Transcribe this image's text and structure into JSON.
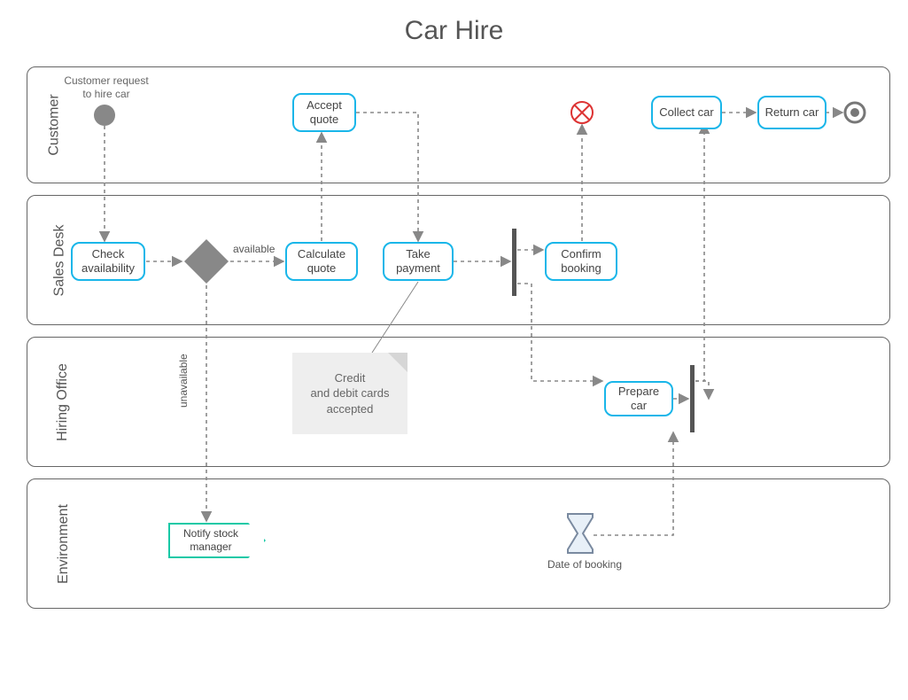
{
  "title": "Car Hire",
  "lanes": {
    "customer": "Customer",
    "sales": "Sales Desk",
    "hiring": "Hiring Office",
    "env": "Environment"
  },
  "start_event_label": "Customer request\nto hire car",
  "tasks": {
    "accept_quote": "Accept quote",
    "collect_car": "Collect car",
    "return_car": "Return car",
    "check_avail": "Check availability",
    "calc_quote": "Calculate quote",
    "take_payment": "Take payment",
    "confirm_book": "Confirm booking",
    "prepare_car": "Prepare car",
    "notify_stock": "Notify stock manager"
  },
  "edge_labels": {
    "available": "available",
    "unavailable": "unavailable"
  },
  "note": "Credit\nand debit cards\naccepted",
  "timer_label": "Date of booking",
  "chart_data": {
    "type": "bpmn_process",
    "title": "Car Hire",
    "pools": [
      {
        "name": "Customer",
        "lanes": [
          "Customer"
        ]
      },
      {
        "name": "Sales Desk",
        "lanes": [
          "Sales Desk"
        ]
      },
      {
        "name": "Hiring Office",
        "lanes": [
          "Hiring Office"
        ]
      },
      {
        "name": "Environment",
        "lanes": [
          "Environment"
        ]
      }
    ],
    "nodes": [
      {
        "id": "start",
        "type": "start_event",
        "lane": "Customer",
        "label": "Customer request to hire car"
      },
      {
        "id": "cancel",
        "type": "cancel_event",
        "lane": "Customer"
      },
      {
        "id": "end",
        "type": "end_event",
        "lane": "Customer"
      },
      {
        "id": "accept_quote",
        "type": "task",
        "lane": "Customer",
        "label": "Accept quote"
      },
      {
        "id": "collect_car",
        "type": "task",
        "lane": "Customer",
        "label": "Collect car"
      },
      {
        "id": "return_car",
        "type": "task",
        "lane": "Customer",
        "label": "Return car"
      },
      {
        "id": "check_avail",
        "type": "task",
        "lane": "Sales Desk",
        "label": "Check availability"
      },
      {
        "id": "gw_avail",
        "type": "exclusive_gateway",
        "lane": "Sales Desk"
      },
      {
        "id": "calc_quote",
        "type": "task",
        "lane": "Sales Desk",
        "label": "Calculate quote"
      },
      {
        "id": "take_payment",
        "type": "task",
        "lane": "Sales Desk",
        "label": "Take payment",
        "annotation": "Credit and debit cards accepted"
      },
      {
        "id": "fork",
        "type": "parallel_gateway",
        "lane": "Sales Desk"
      },
      {
        "id": "confirm_book",
        "type": "task",
        "lane": "Sales Desk",
        "label": "Confirm booking"
      },
      {
        "id": "prepare_car",
        "type": "task",
        "lane": "Hiring Office",
        "label": "Prepare car"
      },
      {
        "id": "join",
        "type": "parallel_gateway",
        "lane": "Hiring Office"
      },
      {
        "id": "notify_stock",
        "type": "send_task",
        "lane": "Environment",
        "label": "Notify stock manager"
      },
      {
        "id": "timer",
        "type": "timer_event",
        "lane": "Environment",
        "label": "Date of booking"
      }
    ],
    "edges": [
      {
        "from": "start",
        "to": "check_avail"
      },
      {
        "from": "check_avail",
        "to": "gw_avail"
      },
      {
        "from": "gw_avail",
        "to": "calc_quote",
        "label": "available"
      },
      {
        "from": "gw_avail",
        "to": "notify_stock",
        "label": "unavailable"
      },
      {
        "from": "calc_quote",
        "to": "accept_quote"
      },
      {
        "from": "accept_quote",
        "to": "take_payment"
      },
      {
        "from": "take_payment",
        "to": "fork"
      },
      {
        "from": "fork",
        "to": "confirm_book"
      },
      {
        "from": "fork",
        "to": "prepare_car"
      },
      {
        "from": "confirm_book",
        "to": "cancel"
      },
      {
        "from": "prepare_car",
        "to": "join"
      },
      {
        "from": "timer",
        "to": "join"
      },
      {
        "from": "join",
        "to": "collect_car"
      },
      {
        "from": "collect_car",
        "to": "return_car"
      },
      {
        "from": "return_car",
        "to": "end"
      }
    ]
  }
}
